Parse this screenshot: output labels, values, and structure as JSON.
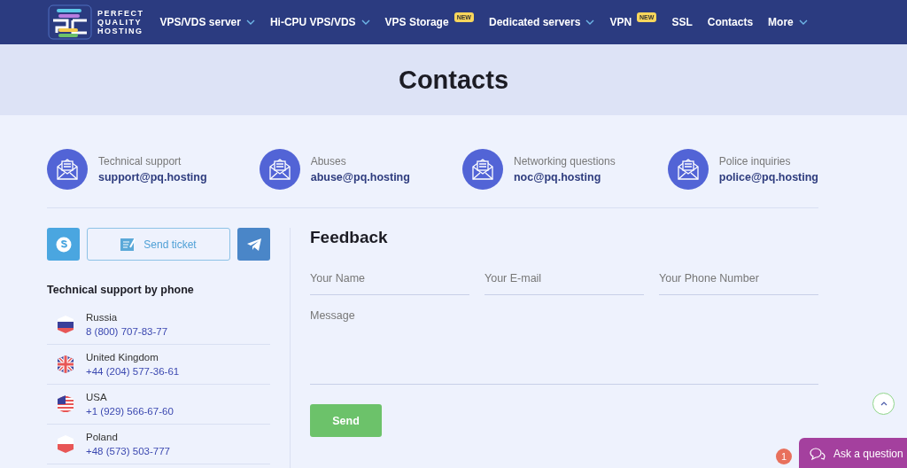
{
  "header": {
    "logo_lines": [
      "PERFECT",
      "QUALITY",
      "HOSTING"
    ],
    "nav": [
      {
        "label": "VPS/VDS server",
        "dropdown": true
      },
      {
        "label": "Hi-CPU VPS/VDS",
        "dropdown": true
      },
      {
        "label": "VPS Storage",
        "dropdown": false,
        "badge": "NEW"
      },
      {
        "label": "Dedicated servers",
        "dropdown": true
      },
      {
        "label": "VPN",
        "dropdown": false,
        "badge": "NEW"
      },
      {
        "label": "SSL",
        "dropdown": false
      },
      {
        "label": "Contacts",
        "dropdown": false
      },
      {
        "label": "More",
        "dropdown": true
      }
    ]
  },
  "page_title": "Contacts",
  "emails": [
    {
      "label": "Technical support",
      "email": "support@pq.hosting"
    },
    {
      "label": "Abuses",
      "email": "abuse@pq.hosting"
    },
    {
      "label": "Networking questions",
      "email": "noc@pq.hosting"
    },
    {
      "label": "Police inquiries",
      "email": "police@pq.hosting"
    }
  ],
  "contact_buttons": [
    {
      "kind": "skype"
    },
    {
      "kind": "ticket",
      "label": "Send ticket"
    },
    {
      "kind": "telegram"
    }
  ],
  "phone_heading": "Technical support by phone",
  "phones": [
    {
      "kind": "ru",
      "country": "Russia",
      "number": "8 (800) 707-83-77"
    },
    {
      "kind": "gb",
      "country": "United Kingdom",
      "number": "+44 (204) 577-36-61"
    },
    {
      "kind": "us",
      "country": "USA",
      "number": "+1 (929) 566-67-60"
    },
    {
      "kind": "pl",
      "country": "Poland",
      "number": "+48 (573) 503-777"
    }
  ],
  "feedback": {
    "title": "Feedback",
    "fields": [
      {
        "placeholder": "Your Name"
      },
      {
        "placeholder": "Your E-mail"
      },
      {
        "placeholder": "Your Phone Number"
      }
    ],
    "message_placeholder": "Message",
    "submit": "Send"
  },
  "chat": {
    "label": "Ask a question",
    "count": "1"
  }
}
